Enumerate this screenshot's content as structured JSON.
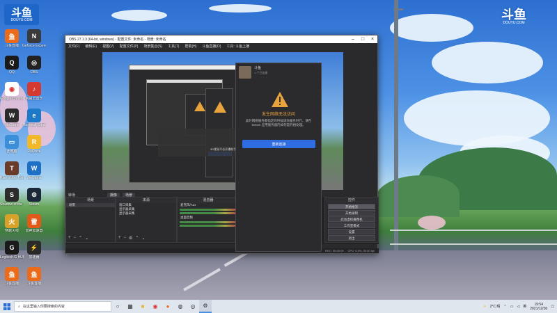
{
  "desktop": {
    "logo_top_left": {
      "big": "斗鱼",
      "small": "DOUYU.COM"
    },
    "logo_top_right": {
      "big": "斗鱼",
      "small": "DOUYU.COM"
    },
    "icons": [
      {
        "label": "斗鱼直播",
        "color": "#e96b1b",
        "glyph": "鱼"
      },
      {
        "label": "Geforce Experience",
        "color": "#3a3a3a",
        "glyph": "N"
      },
      {
        "label": "QQ",
        "color": "#1a1a1a",
        "glyph": "Q"
      },
      {
        "label": "OBS",
        "color": "#222222",
        "glyph": "◎"
      },
      {
        "label": "Google Chrome",
        "color": "#ffffff",
        "glyph": "◉"
      },
      {
        "label": "网易云音乐",
        "color": "#d43a2f",
        "glyph": "♪"
      },
      {
        "label": "WeGame",
        "color": "#2a2a2a",
        "glyph": "W"
      },
      {
        "label": "Microsoft Edge",
        "color": "#1e7ac9",
        "glyph": "e"
      },
      {
        "label": "此电脑",
        "color": "#3b8fd8",
        "glyph": "▭"
      },
      {
        "label": "RaiDrive",
        "color": "#f0b82a",
        "glyph": "R"
      },
      {
        "label": "Rise of the Tomb Raider",
        "color": "#6b3b2a",
        "glyph": "T"
      },
      {
        "label": "WeGame",
        "color": "#1f6fc4",
        "glyph": "W"
      },
      {
        "label": "Shadow of the Tomb Raider",
        "color": "#2b2b2b",
        "glyph": "S"
      },
      {
        "label": "Steam",
        "color": "#1b2838",
        "glyph": "⚙"
      },
      {
        "label": "穿越火线",
        "color": "#d8a22a",
        "glyph": "火"
      },
      {
        "label": "雷神加速器",
        "color": "#e05a1a",
        "glyph": "雷"
      },
      {
        "label": "Logitech G HUB",
        "color": "#1a1a1a",
        "glyph": "G"
      },
      {
        "label": "加速器",
        "color": "#2a2a2a",
        "glyph": "⚡"
      },
      {
        "label": "斗鱼直播",
        "color": "#e96b1b",
        "glyph": "鱼"
      },
      {
        "label": "斗鱼直播",
        "color": "#e96b1b",
        "glyph": "鱼"
      }
    ]
  },
  "obs": {
    "window_title": "OBS 27.1.3 (64-bit, windows) - 配置文件: 未命名 - 场景: 未命名",
    "menu": [
      "文件(F)",
      "编辑(E)",
      "视图(V)",
      "配置文件(P)",
      "场景集合(S)",
      "工具(T)",
      "帮助(H)",
      "斗鱼直播(D)",
      "工具: 斗鱼上播"
    ],
    "bottom_buttons": [
      "摄像",
      "场景"
    ],
    "scenes_panel": {
      "title": "场景",
      "items": [
        "场景"
      ]
    },
    "sources_panel": {
      "title": "来源",
      "items": [
        "窗口采集",
        "显示器采集",
        "显示器采集"
      ]
    },
    "mixer_panel": {
      "title": "混音器",
      "channels": [
        "麦克风/Aux",
        "桌面音频"
      ]
    },
    "transition_label": "转场",
    "controls_panel": {
      "title": "控件",
      "buttons": [
        "开始推流",
        "开始录制",
        "启动虚拟摄像机",
        "工作室模式",
        "设置",
        "退出"
      ]
    },
    "top_scenes_label": "来源设置",
    "status": {
      "live": "LIVE: 00:00:00",
      "rec": "REC: 00:00:00",
      "cpu": "CPU: 0.4%, 30.00 fps"
    }
  },
  "nested": {
    "caption": "3D视觉平台开播助手"
  },
  "dialog": {
    "name": "斗鱼",
    "subtitle": "1 个已连接",
    "title": "发生网络无法访问",
    "message": "此时网络服务都指定的时候请你服务时行，请在 Steam 应用服务器内如何是的相处理。",
    "button": "重新连接"
  },
  "taskbar": {
    "search_placeholder": "在这里输入你要搜索的内容",
    "weather": "2°C 晴",
    "time": "19:54",
    "date": "2021/12/30"
  }
}
